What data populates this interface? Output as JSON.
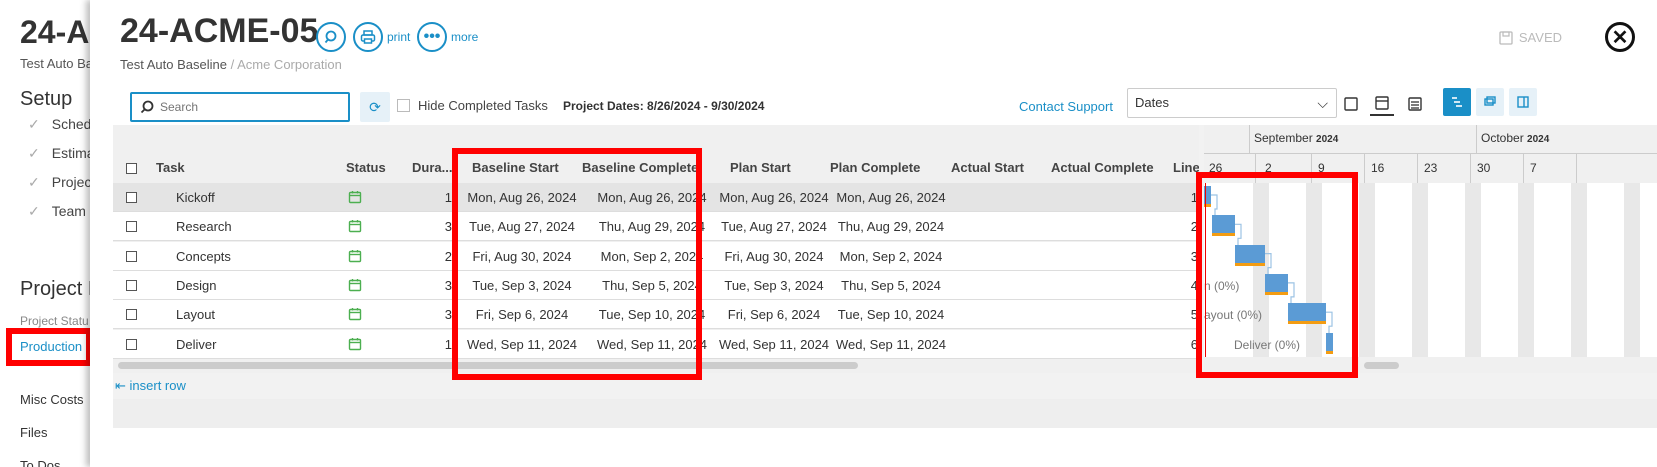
{
  "background": {
    "title": "24-A",
    "subtitle": "Test Auto Ba",
    "setup_heading": "Setup",
    "setup_items": [
      "Sched",
      "Estima",
      "Projec",
      "Team"
    ],
    "project_heading": "Project I",
    "project_status": "Project Statu",
    "production": "Production",
    "misc_costs": "Misc Costs",
    "files": "Files",
    "todos": "To Dos"
  },
  "modal": {
    "title": "24-ACME-05",
    "subtitle_main": "Test Auto Baseline",
    "subtitle_sep": " / ",
    "subtitle_client": "Acme Corporation",
    "print_label": "print",
    "more_label": "more",
    "saved_label": "SAVED"
  },
  "toolbar": {
    "search_placeholder": "Search",
    "hide_completed_label": "Hide Completed Tasks",
    "project_dates": "Project Dates: 8/26/2024 - 9/30/2024",
    "contact_support": "Contact Support",
    "dates_select_value": "Dates"
  },
  "table": {
    "headers": {
      "task": "Task",
      "status": "Status",
      "duration": "Dura...",
      "baseline_start": "Baseline Start",
      "baseline_complete": "Baseline Complete",
      "plan_start": "Plan Start",
      "plan_complete": "Plan Complete",
      "actual_start": "Actual Start",
      "actual_complete": "Actual Complete",
      "line": "Line"
    },
    "rows": [
      {
        "task": "Kickoff",
        "duration": "1",
        "baseline_start": "Mon, Aug 26, 2024",
        "baseline_complete": "Mon, Aug 26, 2024",
        "plan_start": "Mon, Aug 26, 2024",
        "plan_complete": "Mon, Aug 26, 2024",
        "actual_start": "",
        "actual_complete": "",
        "line": "1"
      },
      {
        "task": "Research",
        "duration": "3",
        "baseline_start": "Tue, Aug 27, 2024",
        "baseline_complete": "Thu, Aug 29, 2024",
        "plan_start": "Tue, Aug 27, 2024",
        "plan_complete": "Thu, Aug 29, 2024",
        "actual_start": "",
        "actual_complete": "",
        "line": "2"
      },
      {
        "task": "Concepts",
        "duration": "2",
        "baseline_start": "Fri, Aug 30, 2024",
        "baseline_complete": "Mon, Sep 2, 2024",
        "plan_start": "Fri, Aug 30, 2024",
        "plan_complete": "Mon, Sep 2, 2024",
        "actual_start": "",
        "actual_complete": "",
        "line": "3"
      },
      {
        "task": "Design",
        "duration": "3",
        "baseline_start": "Tue, Sep 3, 2024",
        "baseline_complete": "Thu, Sep 5, 2024",
        "plan_start": "Tue, Sep 3, 2024",
        "plan_complete": "Thu, Sep 5, 2024",
        "actual_start": "",
        "actual_complete": "",
        "line": "4"
      },
      {
        "task": "Layout",
        "duration": "3",
        "baseline_start": "Fri, Sep 6, 2024",
        "baseline_complete": "Tue, Sep 10, 2024",
        "plan_start": "Fri, Sep 6, 2024",
        "plan_complete": "Tue, Sep 10, 2024",
        "actual_start": "",
        "actual_complete": "",
        "line": "5"
      },
      {
        "task": "Deliver",
        "duration": "1",
        "baseline_start": "Wed, Sep 11, 2024",
        "baseline_complete": "Wed, Sep 11, 2024",
        "plan_start": "Wed, Sep 11, 2024",
        "plan_complete": "Wed, Sep 11, 2024",
        "actual_start": "",
        "actual_complete": "",
        "line": "6"
      }
    ],
    "insert_row": "insert row"
  },
  "gantt": {
    "months": [
      {
        "name": "September",
        "year": "2024"
      },
      {
        "name": "October",
        "year": "2024"
      }
    ],
    "days": [
      "26",
      "2",
      "9",
      "16",
      "23",
      "30",
      "7"
    ],
    "bar_labels": {
      "design": "n (0%)",
      "layout": "ayout (0%)",
      "deliver": "Deliver (0%)"
    }
  },
  "colors": {
    "accent": "#1a8fc7",
    "bar": "#5b9bd5",
    "bar_progress": "#f39c12",
    "highlight": "#ff0000",
    "status_icon": "#4caf50"
  }
}
